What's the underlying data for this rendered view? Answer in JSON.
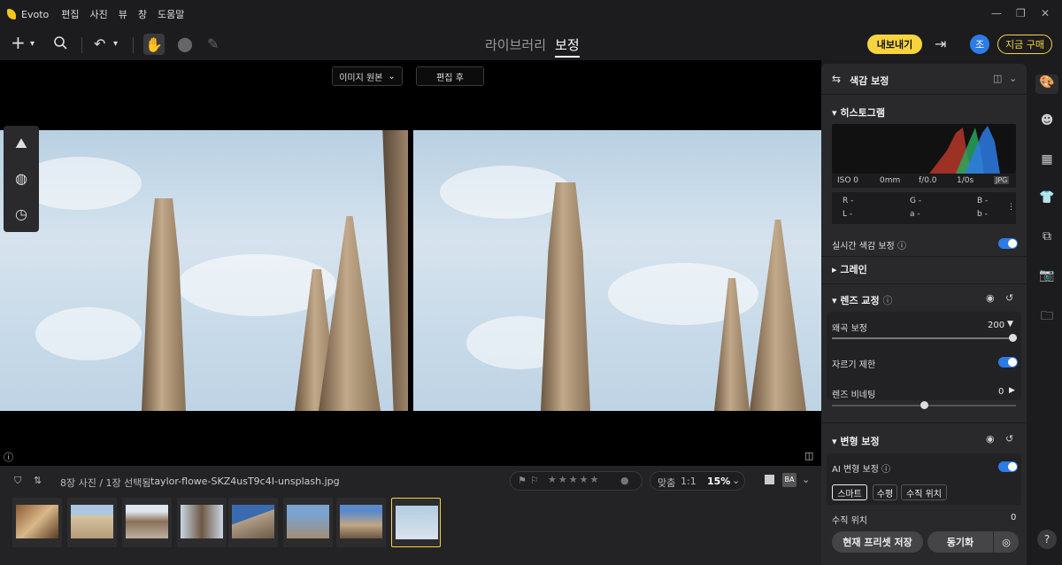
{
  "app": {
    "name": "Evoto",
    "menu": [
      "편집",
      "사진",
      "뷰",
      "창",
      "도움말"
    ]
  },
  "window": {
    "minimize": "—",
    "restore": "❐",
    "close": "✕"
  },
  "toolbar": {
    "tabs": {
      "library": "라이브러리",
      "edit": "보정"
    },
    "export_label": "내보내기",
    "avatar_letter": "조",
    "buy_label": "지금 구매"
  },
  "canvas": {
    "view_mode": "이미지 원본",
    "after_label": "편집 후"
  },
  "filmstrip": {
    "count_label": "8장 사진 / 1장 선택됨",
    "filename": "taylor-flowe-SKZ4usT9c4I-unsplash.jpg",
    "fit_label": "맞춤",
    "one_to_one": "1:1",
    "zoom": "15%",
    "thumb_count": 8,
    "selected_index": 7
  },
  "panel": {
    "title": "색감 보정",
    "histogram": {
      "label": "히스토그램",
      "iso": "ISO 0",
      "focal": "0mm",
      "aperture": "f/0.0",
      "shutter": "1/0s",
      "format": "JPG",
      "r": "R -",
      "g": "G -",
      "b": "B -",
      "l": "L -",
      "a": "a -",
      "b2": "b -"
    },
    "realtime_label": "실시간 색감 보정",
    "grain_label": "그레인",
    "lens": {
      "label": "렌즈 교정",
      "distortion_label": "왜곡 보정",
      "distortion_value": "200",
      "crop_label": "자르기 제한",
      "vignette_label": "렌즈 비네팅",
      "vignette_value": "0"
    },
    "transform": {
      "label": "변형 보정",
      "ai_label": "AI 변형 보정",
      "chips": [
        "스마트",
        "수평",
        "수직 위치"
      ],
      "vertical_label": "수직 위치",
      "vertical_value": "0"
    },
    "save_preset": "현재 프리셋 저장",
    "sync": "동기화"
  },
  "colors": {
    "accent": "#2d7be5",
    "brand": "#f7d33f"
  }
}
